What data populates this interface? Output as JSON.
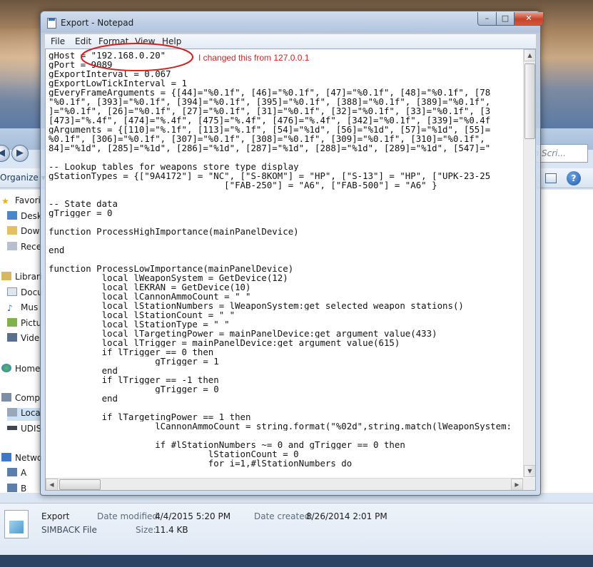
{
  "explorer": {
    "search_placeholder": "ch Scri...",
    "organize_label": "Organize ▾",
    "sidebar": [
      {
        "label": "Favori",
        "icon": "star-icon"
      },
      {
        "label": "Desk",
        "icon": "desktop-icon"
      },
      {
        "label": "Dow",
        "icon": "downloads-icon"
      },
      {
        "label": "Rece",
        "icon": "recent-icon"
      },
      {
        "label": "Librari",
        "icon": "library-icon"
      },
      {
        "label": "Docu",
        "icon": "documents-icon"
      },
      {
        "label": "Mus",
        "icon": "music-icon"
      },
      {
        "label": "Pictu",
        "icon": "pictures-icon"
      },
      {
        "label": "Vide",
        "icon": "videos-icon"
      },
      {
        "label": "Home",
        "icon": "homegroup-icon"
      },
      {
        "label": "Comp",
        "icon": "computer-icon"
      },
      {
        "label": "Loca",
        "icon": "local-disk-icon"
      },
      {
        "label": "UDIS",
        "icon": "drive-icon"
      },
      {
        "label": "Netwo",
        "icon": "network-icon"
      },
      {
        "label": "A",
        "icon": "network-pc-icon"
      },
      {
        "label": "B",
        "icon": "network-pc-icon"
      }
    ],
    "details": {
      "name": "Export",
      "type": "SIMBACK File",
      "modified_label": "Date modified:",
      "modified_value": "4/4/2015 5:20 PM",
      "created_label": "Date created:",
      "created_value": "8/26/2014 2:01 PM",
      "size_label": "Size:",
      "size_value": "11.4 KB"
    }
  },
  "notepad": {
    "title": "Export - Notepad",
    "caption_buttons": {
      "minimize": "–",
      "maximize": "□",
      "close": "✕"
    },
    "menu": [
      "File",
      "Edit",
      "Format",
      "View",
      "Help"
    ],
    "lines": [
      "gHost = \"192.168.0.20\"",
      "gPort = 9089",
      "gExportInterval = 0.067",
      "gExportLowTickInterval = 1",
      "gEveryFrameArguments = {[44]=\"%0.1f\", [46]=\"%0.1f\", [47]=\"%0.1f\", [48]=\"%0.1f\", [78",
      "\"%0.1f\", [393]=\"%0.1f\", [394]=\"%0.1f\", [395]=\"%0.1f\", [388]=\"%0.1f\", [389]=\"%0.1f\",",
      "]=\"%0.1f\", [26]=\"%0.1f\", [27]=\"%0.1f\", [31]=\"%0.1f\", [32]=\"%0.1f\", [33]=\"%0.1f\", [3",
      "[473]=\"%.4f\", [474]=\"%.4f\", [475]=\"%.4f\", [476]=\"%.4f\", [342]=\"%0.1f\", [339]=\"%0.4f",
      "gArguments = {[110]=\"%.1f\", [113]=\"%.1f\", [54]=\"%1d\", [56]=\"%1d\", [57]=\"%1d\", [55]=",
      "%0.1f\", [306]=\"%0.1f\", [307]=\"%0.1f\", [308]=\"%0.1f\", [309]=\"%0.1f\", [310]=\"%0.1f\",",
      "84]=\"%1d\", [285]=\"%1d\", [286]=\"%1d\", [287]=\"%1d\", [288]=\"%1d\", [289]=\"%1d\", [547]=\"",
      "",
      "-- Lookup tables for weapons store type display",
      "gStationTypes = {[\"9A4172\"] = \"NC\", [\"S-8KOM\"] = \"HP\", [\"S-13\"] = \"HP\", [\"UPK-23-25",
      "                                 [\"FAB-250\"] = \"A6\", [\"FAB-500\"] = \"A6\" }",
      "",
      "-- State data",
      "gTrigger = 0",
      "",
      "function ProcessHighImportance(mainPanelDevice)",
      "",
      "end",
      "",
      "function ProcessLowImportance(mainPanelDevice)",
      "          local lWeaponSystem = GetDevice(12)",
      "          local lEKRAN = GetDevice(10)",
      "          local lCannonAmmoCount = \" \"",
      "          local lStationNumbers = lWeaponSystem:get_selected_weapon_stations()",
      "          local lStationCount = \" \"",
      "          local lStationType = \" \"",
      "          local lTargetingPower = mainPanelDevice:get_argument_value(433)",
      "          local lTrigger = mainPanelDevice:get_argument_value(615)",
      "          if lTrigger == 0 then",
      "                    gTrigger = 1",
      "          end",
      "          if lTrigger == -1 then",
      "                    gTrigger = 0",
      "          end",
      "",
      "          if lTargetingPower == 1 then",
      "                    lCannonAmmoCount = string.format(\"%02d\",string.match(lWeaponSystem:",
      "",
      "                    if #lStationNumbers ~= 0 and gTrigger == 0 then",
      "                              lStationCount = 0",
      "                              for i=1,#lStationNumbers do"
    ]
  },
  "annotation": {
    "text": "I changed this from 127.0.0.1",
    "color": "#d52020"
  }
}
